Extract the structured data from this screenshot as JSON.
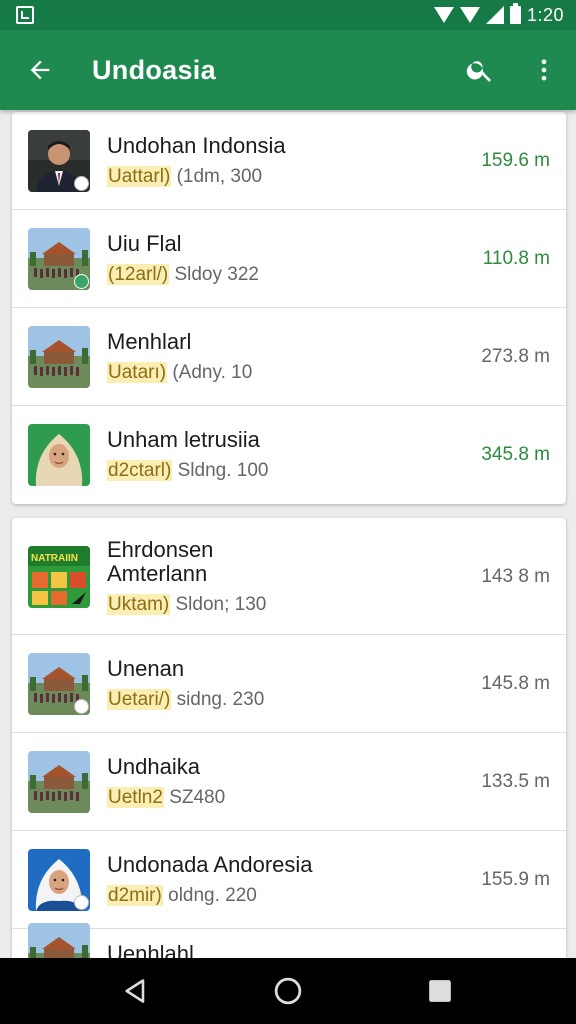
{
  "status": {
    "time": "1:20"
  },
  "appbar": {
    "title": "Undoasia"
  },
  "colors": {
    "primary": "#1e8a4f",
    "status": "#157a45",
    "distance_green": "#2d8a3e",
    "highlight": "#fbeeb3"
  },
  "icons": {
    "back": "arrow-back-icon",
    "search": "search-icon",
    "more": "more-vert-icon"
  },
  "group1": [
    {
      "title": "Undohan Indonsia",
      "sub_hl": "Uattarl)",
      "sub_rest": " (1dm, 300",
      "distance": "159.6 m",
      "dist_green": true,
      "thumb": "portrait-man"
    },
    {
      "title": "Uiu Flal",
      "sub_hl": "(12arl/)",
      "sub_rest": " Sldoy 322",
      "distance": "110.8 m",
      "dist_green": true,
      "thumb": "pavilion"
    },
    {
      "title": "Menhlarl",
      "sub_hl": "Uatarı)",
      "sub_rest": " (Adny. 10",
      "distance": "273.8 m",
      "dist_green": false,
      "thumb": "pavilion"
    },
    {
      "title": "Unham letrusiia",
      "sub_hl": "d2ctarl)",
      "sub_rest": " Sldng. 100",
      "distance": "345.8 m",
      "dist_green": true,
      "thumb": "portrait-hijab"
    }
  ],
  "group2": [
    {
      "title": "Ehrdonsen",
      "title2": "Amterlann",
      "sub_hl": "Uktam)",
      "sub_rest": " Sldon; 130",
      "distance": "143 8 m",
      "dist_green": false,
      "thumb": "poster",
      "thumb_text": "NATRAIIN"
    },
    {
      "title": "Unenan",
      "sub_hl": "Uetari/)",
      "sub_rest": " sidng. 230",
      "distance": "145.8 m",
      "dist_green": false,
      "thumb": "pavilion"
    },
    {
      "title": "Undhaika",
      "sub_hl": "Uetln2",
      "sub_rest": " SZ480",
      "distance": "133.5 m",
      "dist_green": false,
      "thumb": "pavilion"
    },
    {
      "title": "Undonada Andoresia",
      "sub_hl": "d2mir)",
      "sub_rest": " oldng. 220",
      "distance": "155.9 m",
      "dist_green": false,
      "thumb": "portrait-hijab-blue"
    },
    {
      "title": "Uenhlahl",
      "sub_hl": "",
      "sub_rest": "",
      "distance": "",
      "dist_green": false,
      "thumb": "pavilion"
    }
  ]
}
